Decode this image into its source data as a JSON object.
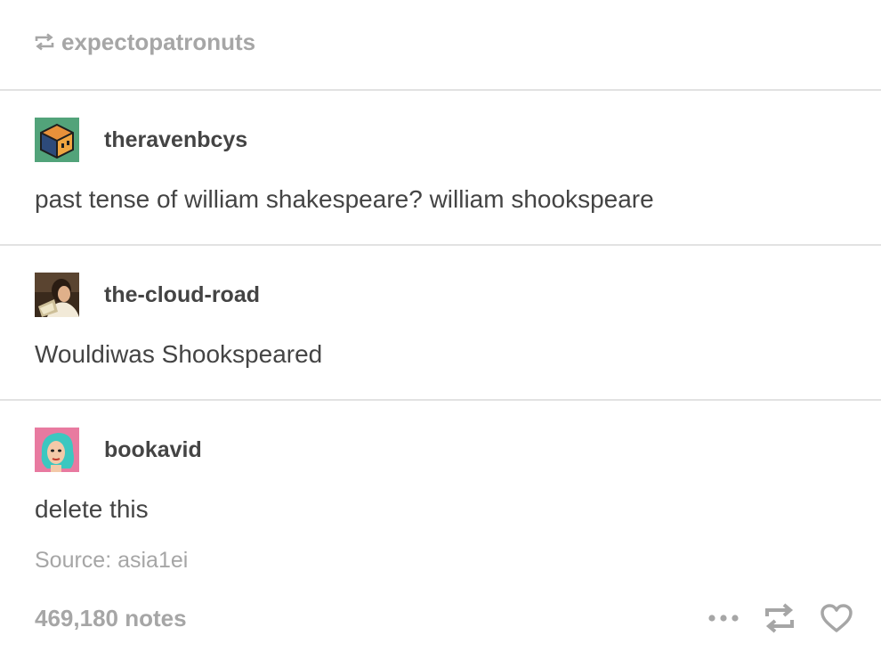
{
  "reblog_header": {
    "icon": "reblog-icon",
    "username": "expectopatronuts"
  },
  "entries": [
    {
      "username": "theravenbcys",
      "avatar": "cube-avatar",
      "text": "past tense of william shakespeare? william shookspeare"
    },
    {
      "username": "the-cloud-road",
      "avatar": "painting-avatar",
      "text": "Wouldiwas Shookspeared"
    },
    {
      "username": "bookavid",
      "avatar": "illustrated-avatar",
      "text": "delete this"
    }
  ],
  "source": {
    "label": "Source: asia1ei"
  },
  "footer": {
    "notes": "469,180 notes",
    "actions": [
      "more-icon",
      "reblog-icon",
      "like-heart-icon"
    ]
  },
  "colors": {
    "text": "#444444",
    "muted": "#a6a6a6",
    "divider": "#e2e2e2"
  }
}
